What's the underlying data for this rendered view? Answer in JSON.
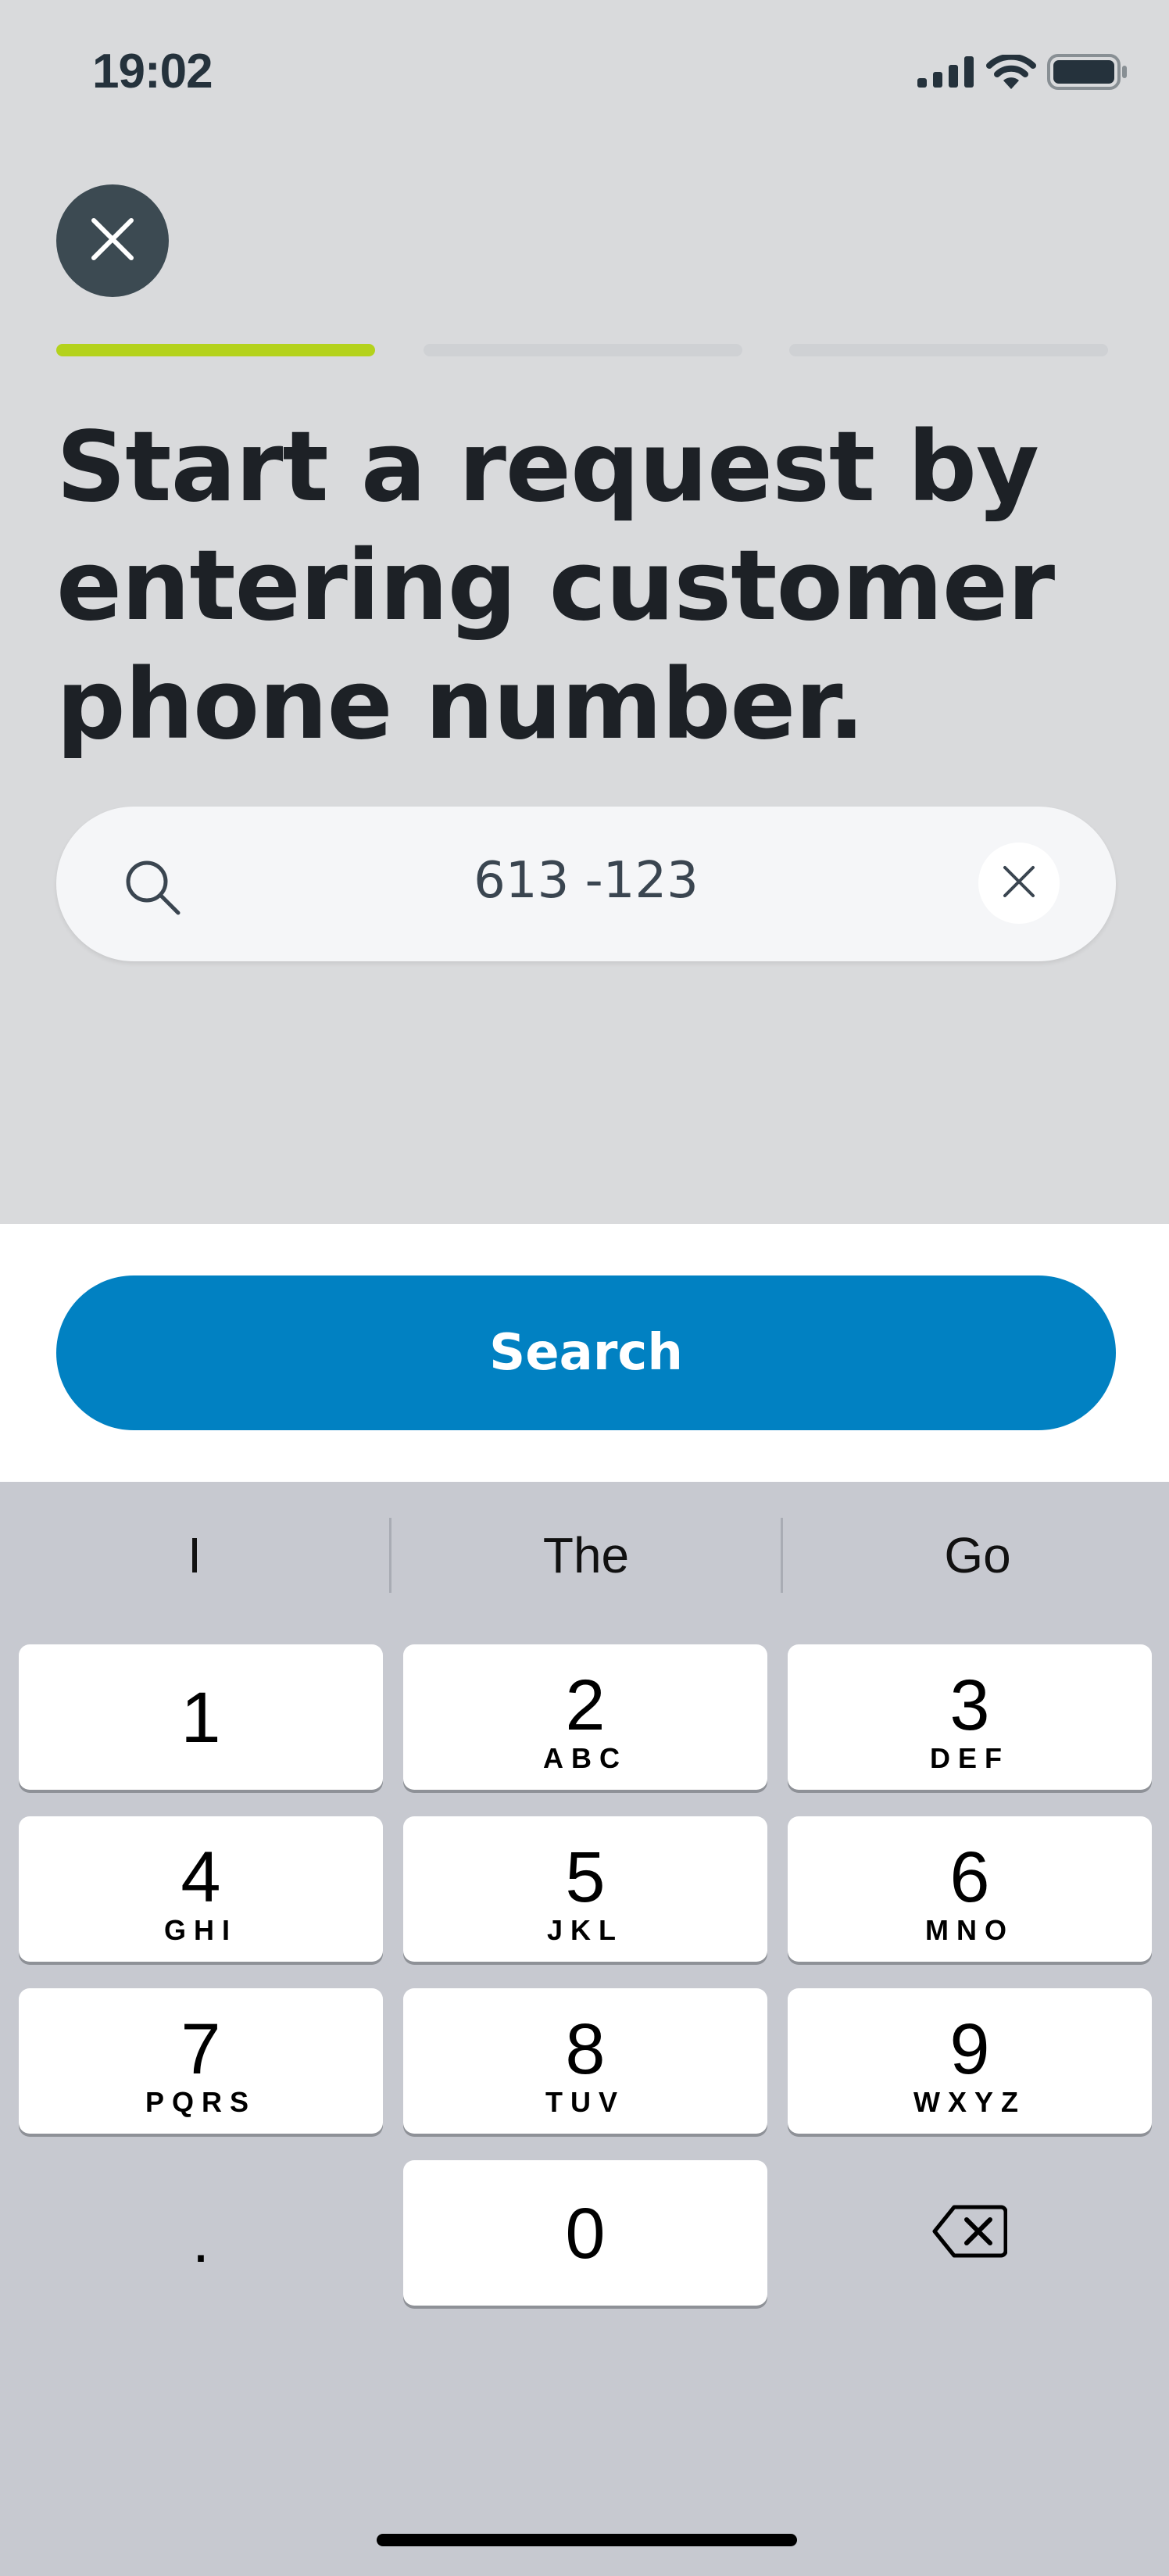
{
  "status_bar": {
    "time": "19:02",
    "icons": [
      "cellular-signal-icon",
      "wifi-icon",
      "battery-icon"
    ]
  },
  "header": {
    "close_icon": "close-icon",
    "progress": {
      "total_steps": 3,
      "current_step": 1
    }
  },
  "headline": "Start a request by entering customer phone number.",
  "search": {
    "icon": "search-icon",
    "value": "613 -123",
    "clear_icon": "clear-icon"
  },
  "action": {
    "search_label": "Search"
  },
  "keyboard": {
    "suggestions": [
      "I",
      "The",
      "Go"
    ],
    "keys": [
      {
        "digit": "1",
        "letters": ""
      },
      {
        "digit": "2",
        "letters": "ABC"
      },
      {
        "digit": "3",
        "letters": "DEF"
      },
      {
        "digit": "4",
        "letters": "GHI"
      },
      {
        "digit": "5",
        "letters": "JKL"
      },
      {
        "digit": "6",
        "letters": "MNO"
      },
      {
        "digit": "7",
        "letters": "PQRS"
      },
      {
        "digit": "8",
        "letters": "TUV"
      },
      {
        "digit": "9",
        "letters": "WXYZ"
      },
      {
        "digit": "0",
        "letters": ""
      }
    ],
    "dot_key": ".",
    "delete_icon": "backspace-icon"
  },
  "colors": {
    "accent": "#0181c2",
    "progress_active": "#b4d21c",
    "close_button": "#3c4a52",
    "background": "#d9dadc",
    "keyboard": "#c7c9d0"
  }
}
